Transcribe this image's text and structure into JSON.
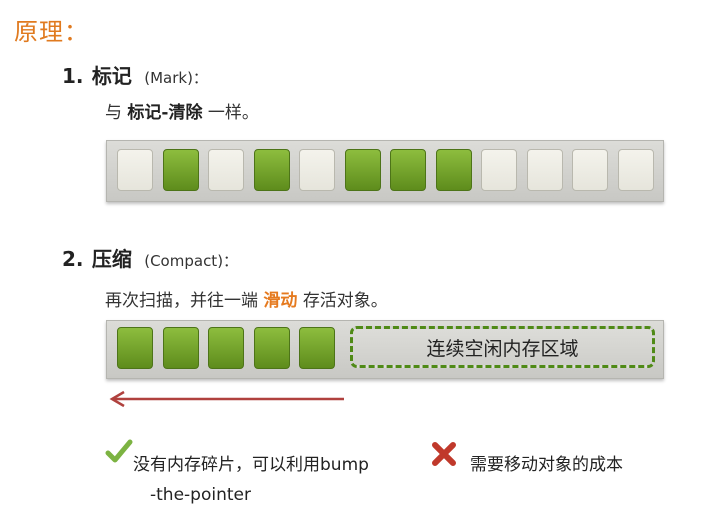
{
  "title": "原理：",
  "section1": {
    "number": "1.",
    "heading": "标记",
    "paren": "(Mark)：",
    "desc_prefix": "与",
    "desc_bold": "标记-清除",
    "desc_suffix": "一样。",
    "cells": [
      "free",
      "used",
      "free",
      "used",
      "free",
      "used",
      "used",
      "used",
      "free",
      "free",
      "free",
      "free"
    ]
  },
  "section2": {
    "number": "2.",
    "heading": "压缩",
    "paren": "(Compact)：",
    "desc_prefix": "再次扫描，并往一端",
    "desc_highlight": "滑动",
    "desc_suffix": "存活对象。",
    "used_count": 5,
    "region_label": "连续空闲内存区域"
  },
  "pro": {
    "icon": "check-icon",
    "line1": "没有内存碎片，可以利用bump",
    "line2": "-the-pointer"
  },
  "con": {
    "icon": "cross-icon",
    "text": "需要移动对象的成本"
  },
  "colors": {
    "title": "#e07a1f",
    "used": "#6f9e26",
    "free": "#efeee6",
    "arrow": "#b0413e",
    "check": "#7cb342",
    "cross": "#c0392b"
  }
}
